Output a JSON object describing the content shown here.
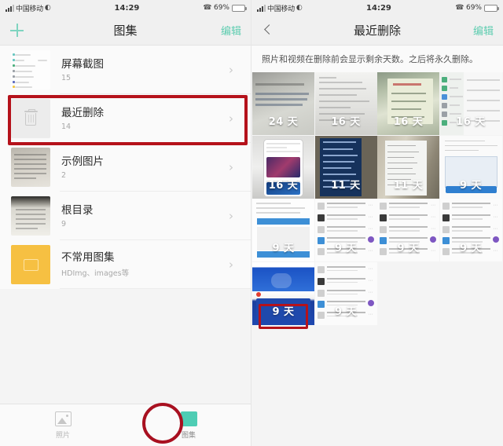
{
  "status_bar": {
    "carrier": "中国移动",
    "time": "14:29",
    "battery_percent": "69%",
    "signal_icon": "signal-bars-icon",
    "wifi_icon": "wifi-icon",
    "volte_icon": "volte-icon",
    "battery_icon": "battery-charging-icon"
  },
  "left_screen": {
    "nav": {
      "add_icon": "plus-icon",
      "title": "图集",
      "edit_label": "编辑"
    },
    "albums": [
      {
        "title": "屏幕截图",
        "count": "15",
        "thumb": "screenshot-list-thumbnail"
      },
      {
        "title": "最近删除",
        "count": "14",
        "thumb": "trash-icon"
      },
      {
        "title": "示例图片",
        "count": "2",
        "thumb": "document-photo-thumbnail"
      },
      {
        "title": "根目录",
        "count": "9",
        "thumb": "document-photo-thumbnail"
      },
      {
        "title": "不常用图集",
        "count": "HDImg、images等",
        "thumb": "folder-icon"
      }
    ],
    "tabs": [
      {
        "label": "照片",
        "icon": "photos-icon",
        "active": false
      },
      {
        "label": "图集",
        "icon": "albums-icon",
        "active": true
      }
    ],
    "annotations": {
      "highlight_row_index": 1,
      "highlight_tab_index": 1,
      "color": "#b5121b"
    }
  },
  "right_screen": {
    "nav": {
      "back_icon": "back-chevron-icon",
      "title": "最近删除",
      "edit_label": "编辑"
    },
    "description": "照片和视频在删除前会显示剩余天数。之后将永久删除。",
    "grid": [
      {
        "days": "24 天",
        "art": "a-screen1"
      },
      {
        "days": "16 天",
        "art": "a-white"
      },
      {
        "days": "16 天",
        "art": "a-green"
      },
      {
        "days": "16 天",
        "art": "a-tabs"
      },
      {
        "days": "16 天",
        "art": "a-phone"
      },
      {
        "days": "11 天",
        "art": "a-dark"
      },
      {
        "days": "11 天",
        "art": "a-room"
      },
      {
        "days": "9 天",
        "art": "a-doc-blue"
      },
      {
        "days": "9 天",
        "art": "a-doc-chart"
      },
      {
        "days": "9 天",
        "art": "a-filelist"
      },
      {
        "days": "9 天",
        "art": "a-filelist"
      },
      {
        "days": "9 天",
        "art": "a-filelist"
      },
      {
        "days": "9 天",
        "art": "a-blue"
      },
      {
        "days": "9 天",
        "art": "a-filelist"
      }
    ],
    "annotations": {
      "highlight_cell_index": 12,
      "color": "#b5121b"
    }
  }
}
